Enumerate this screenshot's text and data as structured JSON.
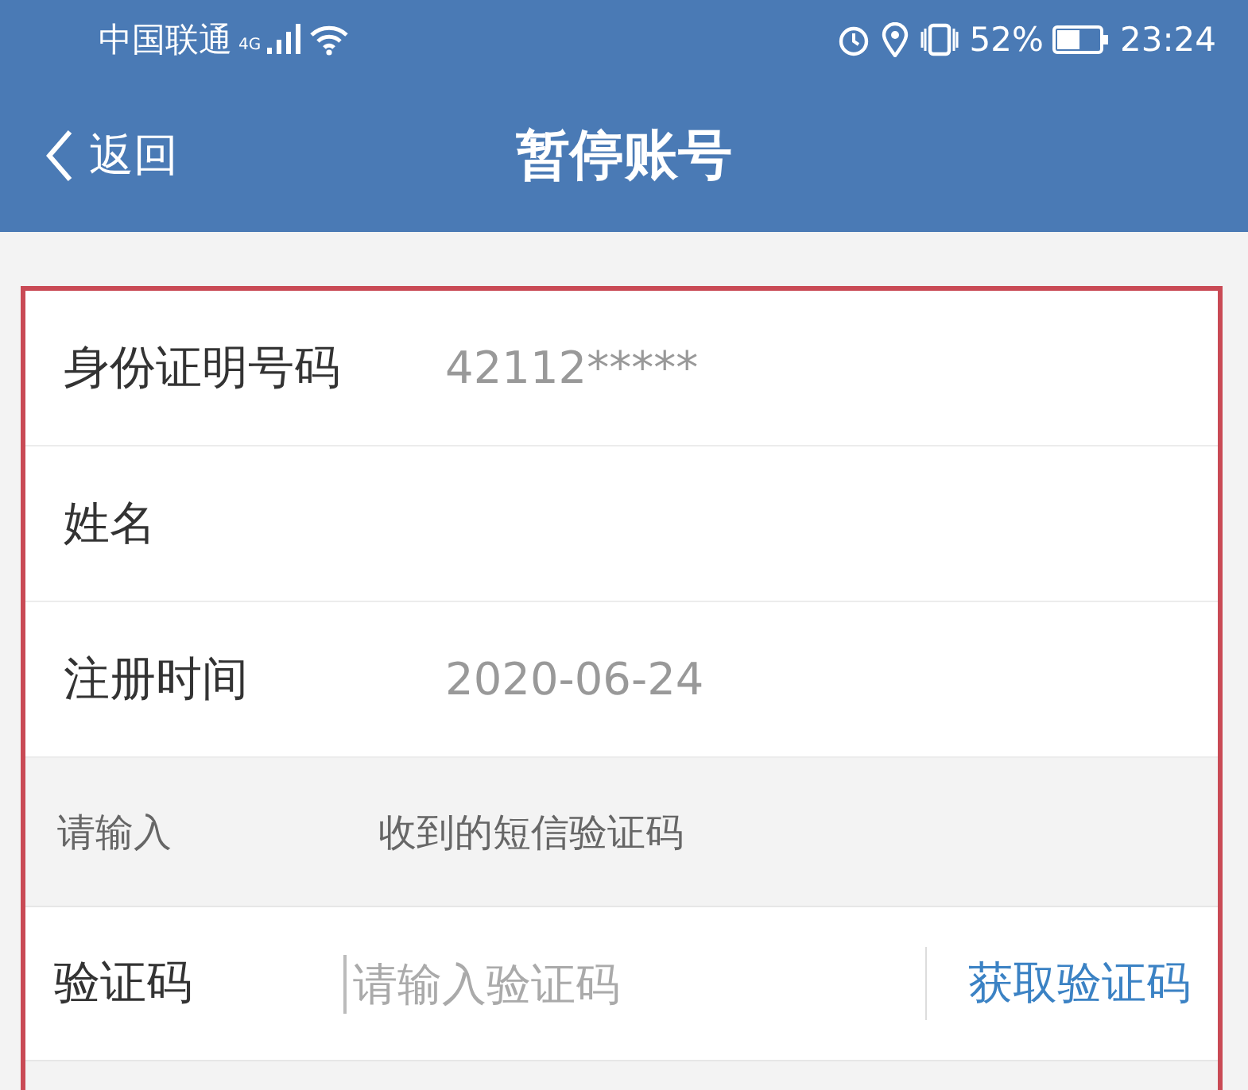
{
  "status_bar": {
    "carrier": "中国联通",
    "network": "4G",
    "battery": "52%",
    "time": "23:24"
  },
  "nav": {
    "back": "返回",
    "title": "暂停账号"
  },
  "rows": [
    {
      "label": "身份证明号码",
      "value": "42112*****"
    },
    {
      "label": "姓名"
    },
    {
      "label": "注册时间",
      "value": "2020-06-24"
    }
  ],
  "sms_hint": {
    "before": "请输入",
    "after": "收到的短信验证码"
  },
  "code_row": {
    "label": "验证码",
    "placeholder": "请输入验证码",
    "button": "获取验证码"
  }
}
